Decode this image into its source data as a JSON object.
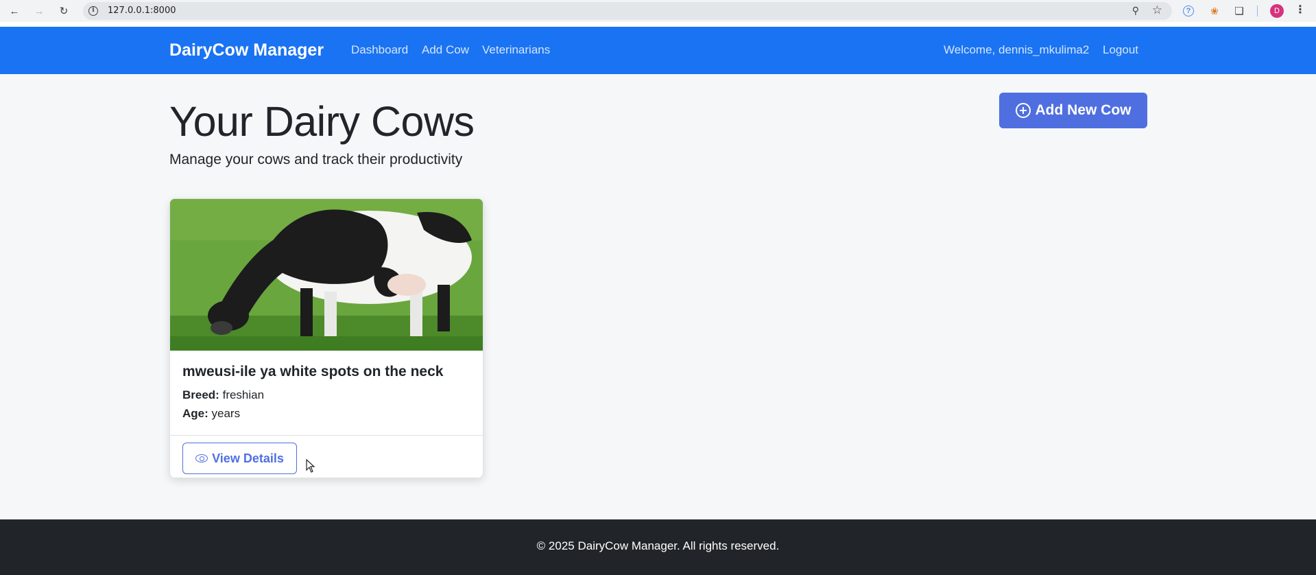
{
  "browser": {
    "url": "127.0.0.1:8000",
    "profile_initial": "D"
  },
  "navbar": {
    "brand": "DairyCow Manager",
    "links": [
      "Dashboard",
      "Add Cow",
      "Veterinarians"
    ],
    "welcome": "Welcome, dennis_mkulima2",
    "logout": "Logout",
    "color": "#1a73f2"
  },
  "main": {
    "title": "Your Dairy Cows",
    "subtitle": "Manage your cows and track their productivity",
    "add_button": "Add New Cow"
  },
  "cows": [
    {
      "name": "mweusi-ile ya white spots on the neck",
      "breed_label": "Breed:",
      "breed": "freshian",
      "age_label": "Age:",
      "age": "years",
      "view_button": "View Details",
      "image": "holstein-cow-grazing"
    }
  ],
  "footer": {
    "text": "© 2025 DairyCow Manager. All rights reserved."
  },
  "colors": {
    "accent": "#4f6fe0",
    "footer_bg": "#212529",
    "page_bg": "#f5f7f8"
  }
}
